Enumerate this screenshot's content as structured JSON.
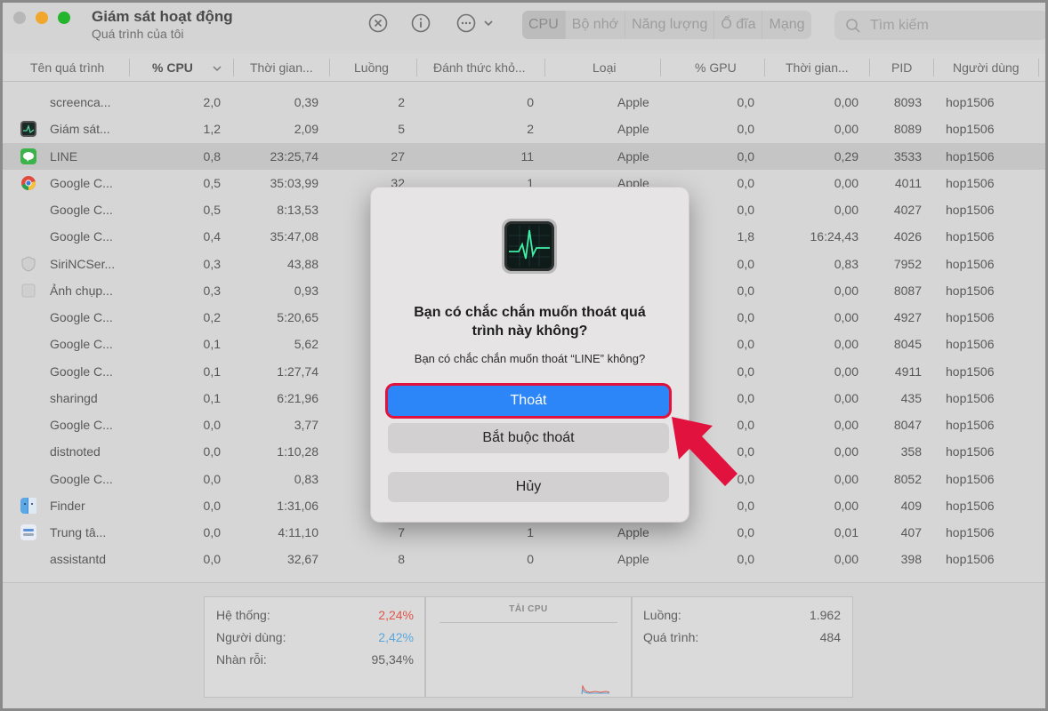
{
  "window": {
    "title": "Giám sát hoạt động",
    "subtitle": "Quá trình của tôi"
  },
  "toolbar": {
    "tabs": [
      "CPU",
      "Bộ nhớ",
      "Năng lượng",
      "Ổ đĩa",
      "Mạng"
    ],
    "active_tab": "CPU",
    "search_placeholder": "Tìm kiếm",
    "icons": [
      "stop-process-icon",
      "info-icon",
      "more-actions-icon"
    ]
  },
  "table": {
    "headers": [
      "Tên quá trình",
      "% CPU",
      "Thời gian...",
      "Luồng",
      "Đánh thức khỏ...",
      "Loại",
      "% GPU",
      "Thời gian...",
      "PID",
      "Người dùng"
    ],
    "rows": [
      {
        "name": "screenca...",
        "cpu": "2,0",
        "time": "0,39",
        "threads": "2",
        "wakes": "0",
        "kind": "Apple",
        "gpu": "0,0",
        "gputime": "0,00",
        "pid": "8093",
        "user": "hop1506",
        "icon": "none"
      },
      {
        "name": "Giám sát...",
        "cpu": "1,2",
        "time": "2,09",
        "threads": "5",
        "wakes": "2",
        "kind": "Apple",
        "gpu": "0,0",
        "gputime": "0,00",
        "pid": "8089",
        "user": "hop1506",
        "icon": "activity-monitor"
      },
      {
        "name": "LINE",
        "cpu": "0,8",
        "time": "23:25,74",
        "threads": "27",
        "wakes": "11",
        "kind": "Apple",
        "gpu": "0,0",
        "gputime": "0,29",
        "pid": "3533",
        "user": "hop1506",
        "icon": "line"
      },
      {
        "name": "Google C...",
        "cpu": "0,5",
        "time": "35:03,99",
        "threads": "32",
        "wakes": "1",
        "kind": "Apple",
        "gpu": "0,0",
        "gputime": "0,00",
        "pid": "4011",
        "user": "hop1506",
        "icon": "chrome"
      },
      {
        "name": "Google C...",
        "cpu": "0,5",
        "time": "8:13,53",
        "threads": "",
        "wakes": "",
        "kind": "",
        "gpu": "0,0",
        "gputime": "0,00",
        "pid": "4027",
        "user": "hop1506",
        "icon": "none"
      },
      {
        "name": "Google C...",
        "cpu": "0,4",
        "time": "35:47,08",
        "threads": "",
        "wakes": "",
        "kind": "",
        "gpu": "1,8",
        "gputime": "16:24,43",
        "pid": "4026",
        "user": "hop1506",
        "icon": "none"
      },
      {
        "name": "SiriNCSer...",
        "cpu": "0,3",
        "time": "43,88",
        "threads": "",
        "wakes": "",
        "kind": "",
        "gpu": "0,0",
        "gputime": "0,83",
        "pid": "7952",
        "user": "hop1506",
        "icon": "shield"
      },
      {
        "name": "Ảnh chụp...",
        "cpu": "0,3",
        "time": "0,93",
        "threads": "",
        "wakes": "",
        "kind": "",
        "gpu": "0,0",
        "gputime": "0,00",
        "pid": "8087",
        "user": "hop1506",
        "icon": "blank"
      },
      {
        "name": "Google C...",
        "cpu": "0,2",
        "time": "5:20,65",
        "threads": "",
        "wakes": "",
        "kind": "",
        "gpu": "0,0",
        "gputime": "0,00",
        "pid": "4927",
        "user": "hop1506",
        "icon": "none"
      },
      {
        "name": "Google C...",
        "cpu": "0,1",
        "time": "5,62",
        "threads": "",
        "wakes": "",
        "kind": "",
        "gpu": "0,0",
        "gputime": "0,00",
        "pid": "8045",
        "user": "hop1506",
        "icon": "none"
      },
      {
        "name": "Google C...",
        "cpu": "0,1",
        "time": "1:27,74",
        "threads": "",
        "wakes": "",
        "kind": "",
        "gpu": "0,0",
        "gputime": "0,00",
        "pid": "4911",
        "user": "hop1506",
        "icon": "none"
      },
      {
        "name": "sharingd",
        "cpu": "0,1",
        "time": "6:21,96",
        "threads": "",
        "wakes": "",
        "kind": "",
        "gpu": "0,0",
        "gputime": "0,00",
        "pid": "435",
        "user": "hop1506",
        "icon": "none"
      },
      {
        "name": "Google C...",
        "cpu": "0,0",
        "time": "3,77",
        "threads": "",
        "wakes": "",
        "kind": "",
        "gpu": "0,0",
        "gputime": "0,00",
        "pid": "8047",
        "user": "hop1506",
        "icon": "none"
      },
      {
        "name": "distnoted",
        "cpu": "0,0",
        "time": "1:10,28",
        "threads": "",
        "wakes": "",
        "kind": "",
        "gpu": "0,0",
        "gputime": "0,00",
        "pid": "358",
        "user": "hop1506",
        "icon": "none"
      },
      {
        "name": "Google C...",
        "cpu": "0,0",
        "time": "0,83",
        "threads": "",
        "wakes": "",
        "kind": "",
        "gpu": "0,0",
        "gputime": "0,00",
        "pid": "8052",
        "user": "hop1506",
        "icon": "none"
      },
      {
        "name": "Finder",
        "cpu": "0,0",
        "time": "1:31,06",
        "threads": "",
        "wakes": "",
        "kind": "",
        "gpu": "0,0",
        "gputime": "0,00",
        "pid": "409",
        "user": "hop1506",
        "icon": "finder"
      },
      {
        "name": "Trung tâ...",
        "cpu": "0,0",
        "time": "4:11,10",
        "threads": "7",
        "wakes": "1",
        "kind": "Apple",
        "gpu": "0,0",
        "gputime": "0,01",
        "pid": "407",
        "user": "hop1506",
        "icon": "control-center"
      },
      {
        "name": "assistantd",
        "cpu": "0,0",
        "time": "32,67",
        "threads": "8",
        "wakes": "0",
        "kind": "Apple",
        "gpu": "0,0",
        "gputime": "0,00",
        "pid": "398",
        "user": "hop1506",
        "icon": "none"
      }
    ]
  },
  "footer": {
    "system_label": "Hệ thống:",
    "system_value": "2,24%",
    "user_label": "Người dùng:",
    "user_value": "2,42%",
    "idle_label": "Nhàn rỗi:",
    "idle_value": "95,34%",
    "cpu_load_title": "TẢI CPU",
    "threads_label": "Luồng:",
    "threads_value": "1.962",
    "processes_label": "Quá trình:",
    "processes_value": "484",
    "colors": {
      "system": "#e0564d",
      "user": "#5aa6dc"
    }
  },
  "dialog": {
    "title": "Bạn có chắc chắn muốn thoát quá trình này không?",
    "message": "Bạn có chắc chắn muốn thoát “LINE” không?",
    "quit_label": "Thoát",
    "force_quit_label": "Bắt buộc thoát",
    "cancel_label": "Hủy",
    "icon": "activity-monitor-icon",
    "highlight_color": "#e2123f"
  }
}
